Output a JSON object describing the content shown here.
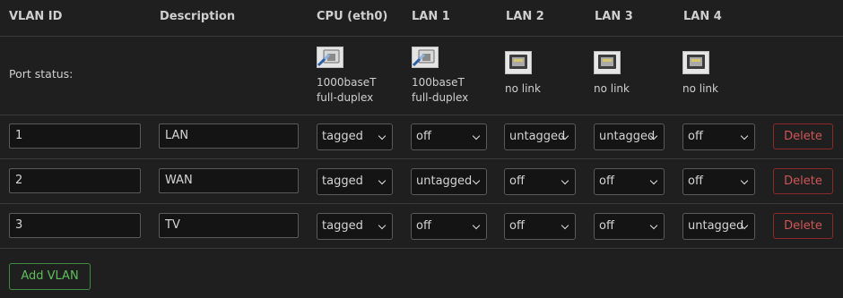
{
  "headers": {
    "vlan_id": "VLAN ID",
    "description": "Description",
    "cpu": "CPU (eth0)",
    "lan1": "LAN 1",
    "lan2": "LAN 2",
    "lan3": "LAN 3",
    "lan4": "LAN 4"
  },
  "port_status": {
    "label": "Port status:",
    "ports": [
      {
        "line1": "1000baseT",
        "line2": "full-duplex",
        "icon": "port-connected-icon"
      },
      {
        "line1": "100baseT",
        "line2": "full-duplex",
        "icon": "port-connected-icon"
      },
      {
        "line1": "no link",
        "line2": "",
        "icon": "port-no-link-icon"
      },
      {
        "line1": "no link",
        "line2": "",
        "icon": "port-no-link-icon"
      },
      {
        "line1": "no link",
        "line2": "",
        "icon": "port-no-link-icon"
      }
    ]
  },
  "vlans": [
    {
      "id": "1",
      "description": "LAN",
      "cpu": "tagged",
      "lan1": "off",
      "lan2": "untagged",
      "lan3": "untagged",
      "lan4": "off"
    },
    {
      "id": "2",
      "description": "WAN",
      "cpu": "tagged",
      "lan1": "untagged",
      "lan2": "off",
      "lan3": "off",
      "lan4": "off"
    },
    {
      "id": "3",
      "description": "TV",
      "cpu": "tagged",
      "lan1": "off",
      "lan2": "off",
      "lan3": "off",
      "lan4": "untagged"
    }
  ],
  "actions": {
    "delete_label": "Delete",
    "add_label": "Add VLAN"
  },
  "colors": {
    "background": "#1f1f1f",
    "delete": "#d05555",
    "add": "#5cbf5c"
  }
}
